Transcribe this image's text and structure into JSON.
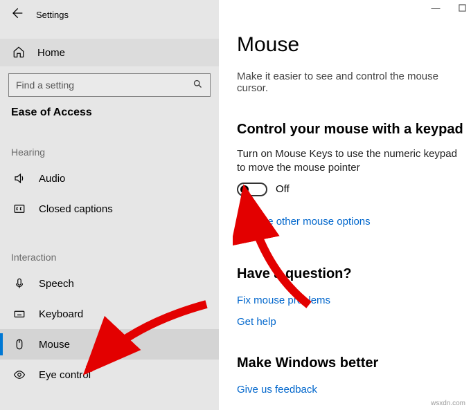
{
  "window": {
    "app_title": "Settings",
    "minimize": "—",
    "maximize": "▢"
  },
  "sidebar": {
    "home_label": "Home",
    "search_placeholder": "Find a setting",
    "category_label": "Ease of Access",
    "groups": {
      "hearing": "Hearing",
      "interaction": "Interaction"
    },
    "items": {
      "audio": "Audio",
      "closed_captions": "Closed captions",
      "speech": "Speech",
      "keyboard": "Keyboard",
      "mouse": "Mouse",
      "eye_control": "Eye control"
    }
  },
  "content": {
    "title": "Mouse",
    "subtitle": "Make it easier to see and control the mouse cursor.",
    "keypad_heading": "Control your mouse with a keypad",
    "keypad_desc": "Turn on Mouse Keys to use the numeric keypad to move the mouse pointer",
    "toggle_state": "Off",
    "change_other": "Change other mouse options",
    "question_heading": "Have a question?",
    "fix_problems": "Fix mouse problems",
    "get_help": "Get help",
    "better_heading": "Make Windows better",
    "give_feedback": "Give us feedback"
  },
  "watermark": "wsxdn.com"
}
